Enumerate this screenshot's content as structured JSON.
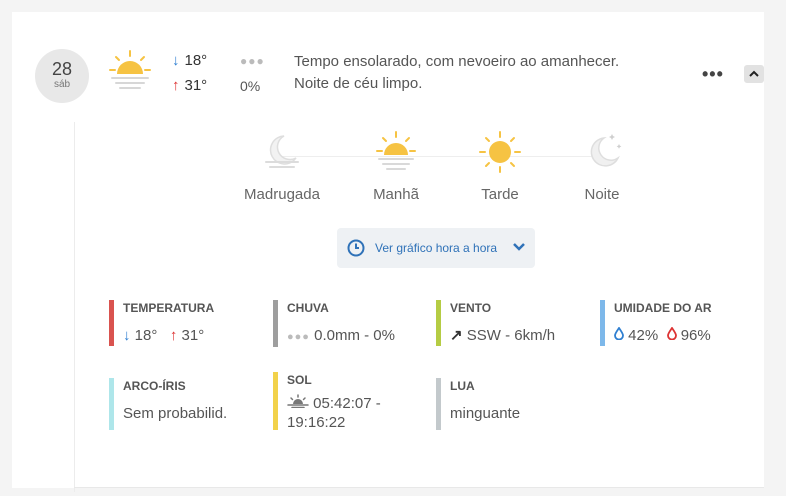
{
  "day": {
    "number": "28",
    "name": "sáb"
  },
  "summary": {
    "min_temp": "18°",
    "max_temp": "31°",
    "rain_prob": "0%",
    "description_line1": "Tempo ensolarado, com nevoeiro ao amanhecer.",
    "description_line2": "Noite de céu limpo.",
    "icon": "sun-fog-icon"
  },
  "periods": [
    {
      "label": "Madrugada",
      "icon": "moon-fog-icon"
    },
    {
      "label": "Manhã",
      "icon": "sun-fog-icon"
    },
    {
      "label": "Tarde",
      "icon": "sun-icon"
    },
    {
      "label": "Noite",
      "icon": "moon-stars-icon"
    }
  ],
  "hourly_button": {
    "label": "Ver gráfico hora a hora"
  },
  "stats": {
    "temperature": {
      "title": "TEMPERATURA",
      "min": "18°",
      "max": "31°",
      "color": "#d9534f"
    },
    "rain": {
      "title": "CHUVA",
      "value": "0.0mm - 0%",
      "color": "#9e9e9e"
    },
    "wind": {
      "title": "VENTO",
      "value": "SSW - 6km/h",
      "color": "#b5cc44"
    },
    "humidity": {
      "title": "UMIDADE DO AR",
      "min": "42%",
      "max": "96%",
      "color": "#7db8ea"
    },
    "rainbow": {
      "title": "ARCO-ÍRIS",
      "value": "Sem probabilid.",
      "color": "#aee6ea"
    },
    "sun": {
      "title": "SOL",
      "value": "05:42:07 - 19:16:22",
      "color": "#f2d24a"
    },
    "moon": {
      "title": "LUA",
      "value": "minguante",
      "color": "#c3c9cc"
    }
  },
  "colors": {
    "sun": "#f6c343",
    "arrow_down": "#2f7fd1",
    "arrow_up": "#dd3333",
    "link": "#2f72b8"
  }
}
